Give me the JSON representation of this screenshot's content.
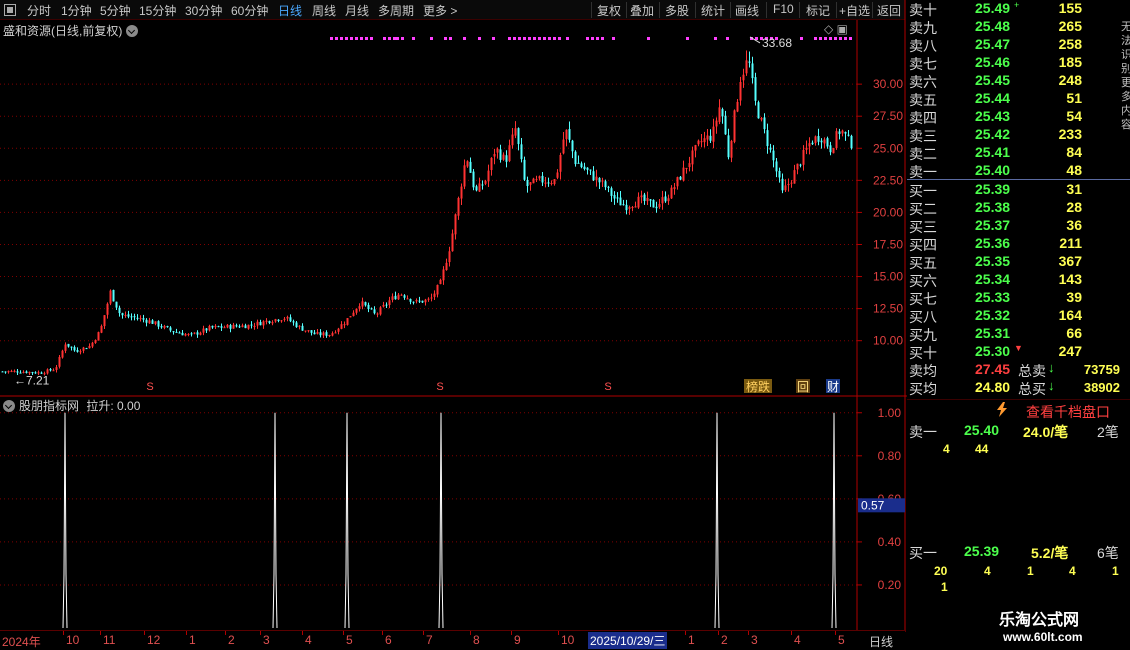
{
  "toolbar": {
    "left_items": [
      "分时",
      "1分钟",
      "5分钟",
      "15分钟",
      "30分钟",
      "60分钟",
      "日线",
      "周线",
      "月线",
      "多周期",
      "更多"
    ],
    "more_glyph": ">",
    "right_items": [
      "复权",
      "叠加",
      "多股",
      "统计",
      "画线",
      "F10",
      "标记",
      "+自选",
      "返回"
    ],
    "active_item": "日线"
  },
  "main_chart": {
    "title": "盛和资源(日线,前复权)",
    "high_label": "33.68",
    "low_label": "7.21",
    "low_arrow": "←",
    "tags": [
      "榜跌",
      "回",
      "财"
    ],
    "s_marker": "S",
    "right_icons": [
      "◇",
      "▣"
    ]
  },
  "indicator": {
    "title": "股朋指标网",
    "value_label": "拉升: 0.00",
    "current_value": "0.57"
  },
  "chart_data": [
    {
      "type": "candlestick",
      "title": "盛和资源(日线,前复权)",
      "y_ticks": [
        10.0,
        12.5,
        15.0,
        17.5,
        20.0,
        22.5,
        25.0,
        27.5,
        30.0
      ],
      "y_tick_labels": [
        "10.00",
        "12.50",
        "15.00",
        "17.50",
        "20.00",
        "22.50",
        "25.00",
        "27.50",
        "30.00"
      ],
      "ylim": [
        6.0,
        35.0
      ],
      "approx_close_path": [
        [
          0,
          7.6
        ],
        [
          20,
          7.6
        ],
        [
          40,
          7.5
        ],
        [
          55,
          7.8
        ],
        [
          65,
          9.8
        ],
        [
          75,
          9.2
        ],
        [
          90,
          9.6
        ],
        [
          100,
          10.8
        ],
        [
          110,
          13.8
        ],
        [
          120,
          12.0
        ],
        [
          135,
          11.8
        ],
        [
          150,
          11.5
        ],
        [
          170,
          10.8
        ],
        [
          190,
          10.4
        ],
        [
          210,
          11.0
        ],
        [
          230,
          11.1
        ],
        [
          250,
          11.2
        ],
        [
          270,
          11.6
        ],
        [
          285,
          11.8
        ],
        [
          300,
          11.0
        ],
        [
          315,
          10.5
        ],
        [
          330,
          10.5
        ],
        [
          345,
          11.5
        ],
        [
          360,
          13.0
        ],
        [
          375,
          12.0
        ],
        [
          390,
          13.2
        ],
        [
          400,
          13.7
        ],
        [
          415,
          13.0
        ],
        [
          430,
          13.2
        ],
        [
          440,
          14.5
        ],
        [
          450,
          17.5
        ],
        [
          458,
          21.0
        ],
        [
          466,
          24.5
        ],
        [
          475,
          21.5
        ],
        [
          485,
          22.5
        ],
        [
          495,
          25.0
        ],
        [
          505,
          24.0
        ],
        [
          515,
          26.5
        ],
        [
          525,
          22.0
        ],
        [
          540,
          22.5
        ],
        [
          555,
          22.5
        ],
        [
          565,
          26.5
        ],
        [
          575,
          24.0
        ],
        [
          590,
          23.0
        ],
        [
          605,
          22.0
        ],
        [
          615,
          21.0
        ],
        [
          625,
          20.5
        ],
        [
          640,
          21.0
        ],
        [
          655,
          20.5
        ],
        [
          670,
          21.5
        ],
        [
          685,
          23.5
        ],
        [
          700,
          25.5
        ],
        [
          712,
          26.0
        ],
        [
          720,
          28.5
        ],
        [
          728,
          24.5
        ],
        [
          740,
          30.5
        ],
        [
          748,
          32.0
        ],
        [
          755,
          28.5
        ],
        [
          765,
          26.0
        ],
        [
          775,
          23.5
        ],
        [
          782,
          21.5
        ],
        [
          790,
          22.5
        ],
        [
          800,
          24.0
        ],
        [
          810,
          25.5
        ],
        [
          820,
          26.0
        ],
        [
          830,
          25.0
        ],
        [
          840,
          26.5
        ],
        [
          850,
          25.4
        ]
      ],
      "markers": {
        "high": {
          "x": 750,
          "value": 33.68
        },
        "low": {
          "x": 42,
          "value": 7.21
        }
      },
      "s_markers_x": [
        150,
        440,
        608
      ]
    },
    {
      "type": "bar",
      "title": "股朋指标网 拉升",
      "y_ticks": [
        0.2,
        0.4,
        0.6,
        0.8,
        1.0
      ],
      "y_tick_labels": [
        "0.20",
        "0.40",
        "0.60",
        "0.80",
        "1.00"
      ],
      "ylim": [
        0.0,
        1.05
      ],
      "spike_x": [
        65,
        275,
        347,
        441,
        717,
        834
      ],
      "spike_values": [
        1.0,
        1.0,
        1.0,
        1.0,
        1.0,
        1.0
      ],
      "current_value": 0.57
    }
  ],
  "order_book": {
    "asks": [
      {
        "label": "卖十",
        "price": "25.49",
        "mark": "+",
        "volume": "155"
      },
      {
        "label": "卖九",
        "price": "25.48",
        "mark": "",
        "volume": "265"
      },
      {
        "label": "卖八",
        "price": "25.47",
        "mark": "",
        "volume": "258"
      },
      {
        "label": "卖七",
        "price": "25.46",
        "mark": "",
        "volume": "185"
      },
      {
        "label": "卖六",
        "price": "25.45",
        "mark": "",
        "volume": "248"
      },
      {
        "label": "卖五",
        "price": "25.44",
        "mark": "",
        "volume": "51"
      },
      {
        "label": "卖四",
        "price": "25.43",
        "mark": "",
        "volume": "54"
      },
      {
        "label": "卖三",
        "price": "25.42",
        "mark": "",
        "volume": "233"
      },
      {
        "label": "卖二",
        "price": "25.41",
        "mark": "",
        "volume": "84"
      },
      {
        "label": "卖一",
        "price": "25.40",
        "mark": "",
        "volume": "48"
      }
    ],
    "bids": [
      {
        "label": "买一",
        "price": "25.39",
        "mark": "",
        "volume": "31"
      },
      {
        "label": "买二",
        "price": "25.38",
        "mark": "",
        "volume": "28"
      },
      {
        "label": "买三",
        "price": "25.37",
        "mark": "",
        "volume": "36"
      },
      {
        "label": "买四",
        "price": "25.36",
        "mark": "",
        "volume": "211"
      },
      {
        "label": "买五",
        "price": "25.35",
        "mark": "",
        "volume": "367"
      },
      {
        "label": "买六",
        "price": "25.34",
        "mark": "",
        "volume": "143"
      },
      {
        "label": "买七",
        "price": "25.33",
        "mark": "",
        "volume": "39"
      },
      {
        "label": "买八",
        "price": "25.32",
        "mark": "",
        "volume": "164"
      },
      {
        "label": "买九",
        "price": "25.31",
        "mark": "",
        "volume": "66"
      },
      {
        "label": "买十",
        "price": "25.30",
        "mark": "▼",
        "volume": "247"
      }
    ],
    "summary": {
      "sell_avg_label": "卖均",
      "sell_avg": "27.45",
      "sell_total_label": "总卖",
      "sell_total": "73759",
      "buy_avg_label": "买均",
      "buy_avg": "24.80",
      "buy_total_label": "总买",
      "buy_total": "38902",
      "arrow": "↓"
    }
  },
  "level_panel": {
    "button_label": "查看千档盘口",
    "sell1": {
      "label": "卖一",
      "price": "25.40",
      "per": "24.0/笔",
      "count": "2笔"
    },
    "sell1_nums": [
      "4",
      "44"
    ],
    "buy1": {
      "label": "买一",
      "price": "25.39",
      "per": "5.2/笔",
      "count": "6笔"
    },
    "buy1_nums_row1": [
      "20",
      "4",
      "1",
      "4",
      "1"
    ],
    "buy1_nums_row2": [
      "1"
    ]
  },
  "time_axis": {
    "labels": [
      {
        "text": "2024年",
        "x": 2
      },
      {
        "text": "10",
        "x": 66
      },
      {
        "text": "11",
        "x": 103
      },
      {
        "text": "12",
        "x": 147
      },
      {
        "text": "1",
        "x": 189
      },
      {
        "text": "2",
        "x": 228
      },
      {
        "text": "3",
        "x": 263
      },
      {
        "text": "4",
        "x": 305
      },
      {
        "text": "5",
        "x": 346
      },
      {
        "text": "6",
        "x": 385
      },
      {
        "text": "7",
        "x": 426
      },
      {
        "text": "8",
        "x": 473
      },
      {
        "text": "9",
        "x": 514
      },
      {
        "text": "10",
        "x": 561
      },
      {
        "text": "1",
        "x": 688
      },
      {
        "text": "2",
        "x": 721
      },
      {
        "text": "3",
        "x": 751
      },
      {
        "text": "4",
        "x": 794
      },
      {
        "text": "5",
        "x": 838
      }
    ],
    "cursor_date": "2025/10/29/三",
    "period": "日线"
  },
  "side_strip": "无法识别更多内容",
  "watermark": {
    "title": "乐淘公式网",
    "url": "www.60lt.com"
  },
  "colors": {
    "up": "#ff3232",
    "down": "#54ffff",
    "grid": "#800000",
    "axis_text": "#e04040",
    "price_green": "#4cff4c",
    "volume_yellow": "#ffff54",
    "highlight_bg": "#1a2d8c",
    "magenta": "#ff40ff"
  }
}
